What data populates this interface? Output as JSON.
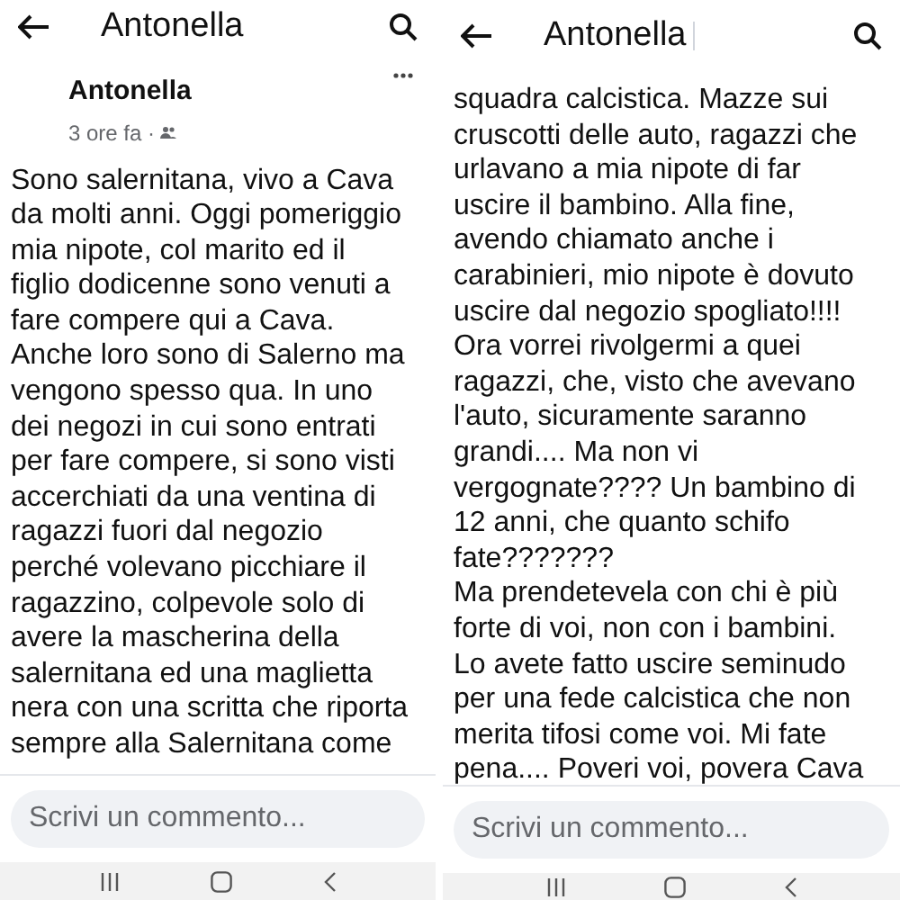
{
  "screens": [
    {
      "header": {
        "title": "Antonella"
      },
      "post": {
        "author": "Antonella",
        "time": "3 ore fa ·",
        "lines": [
          "Sono salernitana, vivo a Cava",
          "da molti anni. Oggi pomeriggio",
          "mia nipote, col marito ed il",
          "figlio dodicenne sono venuti a",
          "fare compere qui a Cava.",
          "Anche loro sono di Salerno ma",
          "vengono spesso qua. In uno",
          "dei negozi in cui sono entrati",
          "per fare compere, si sono visti",
          "accerchiati da una ventina di",
          "ragazzi fuori dal negozio",
          "perché volevano picchiare il",
          "ragazzino, colpevole solo di",
          "avere la mascherina della",
          "salernitana ed una maglietta",
          "nera con una scritta che riporta",
          "sempre alla Salernitana come"
        ]
      },
      "comment_field": {
        "placeholder": "Scrivi un commento..."
      }
    },
    {
      "header": {
        "title": "Antonella"
      },
      "post": {
        "lines": [
          "squadra calcistica. Mazze sui",
          "cruscotti delle auto, ragazzi che",
          "urlavano a mia nipote di far",
          "uscire il bambino. Alla fine,",
          "avendo chiamato anche i",
          "carabinieri, mio nipote è dovuto",
          "uscire dal negozio spogliato!!!!",
          "Ora vorrei rivolgermi a quei",
          "ragazzi, che, visto che avevano",
          "l'auto, sicuramente saranno",
          "grandi.... Ma non vi",
          "vergognate???? Un bambino di",
          "12 anni, che quanto schifo",
          "fate???????",
          "Ma prendetevela con chi è più",
          "forte di voi, non con i bambini.",
          "Lo avete fatto uscire seminudo",
          "per una fede calcistica che non",
          "merita tifosi come voi. Mi fate",
          "pena.... Poveri voi, povera Cava"
        ]
      },
      "comment_field": {
        "placeholder": "Scrivi un commento..."
      }
    }
  ]
}
